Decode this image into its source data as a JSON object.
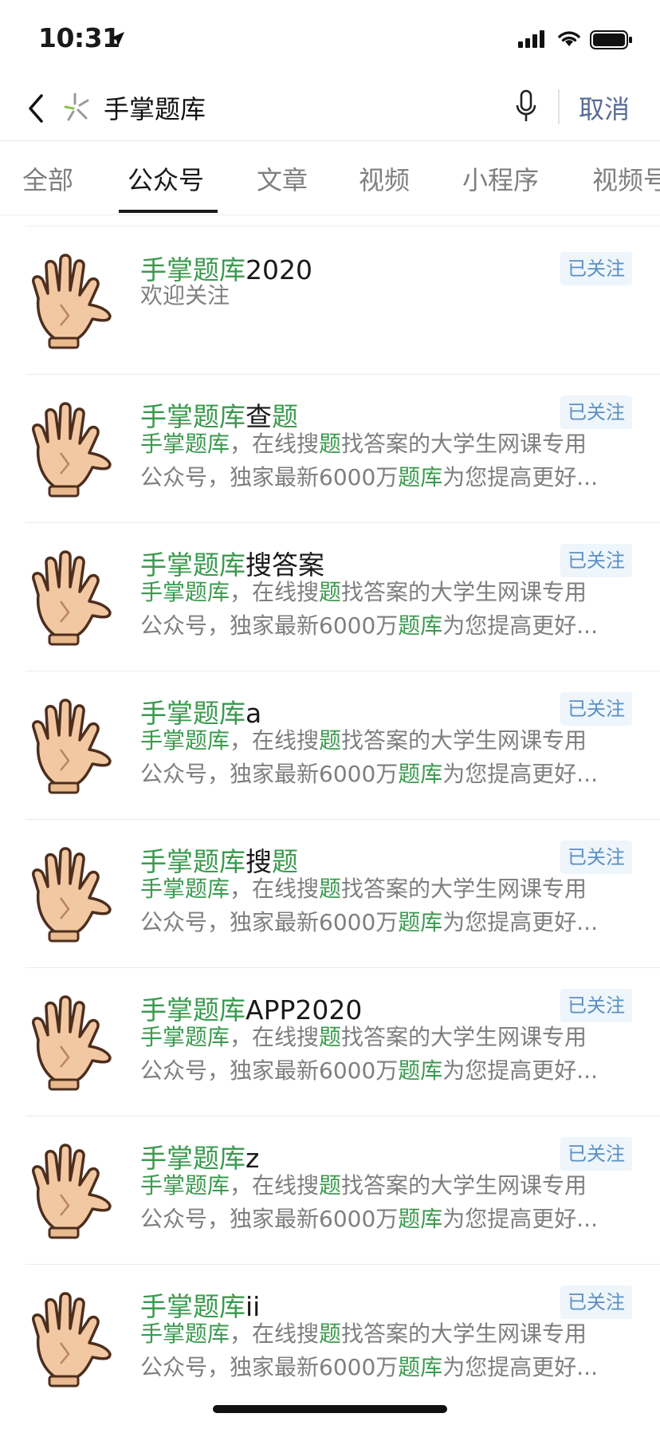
{
  "status_bar": {
    "time": "10:31"
  },
  "search": {
    "query": "手掌题库",
    "cancel_label": "取消"
  },
  "tabs": [
    {
      "label": "全部"
    },
    {
      "label": "公众号"
    },
    {
      "label": "文章"
    },
    {
      "label": "视频"
    },
    {
      "label": "小程序"
    },
    {
      "label": "视频号"
    }
  ],
  "active_tab": "公众号",
  "colors": {
    "highlight": "#3a9a4e",
    "link": "#576b95",
    "follow_badge_bg": "#eef5fb",
    "follow_badge_text": "#5b8fc2"
  },
  "results": [
    {
      "title_hl": "手掌题库",
      "title_rest": "2020",
      "follow": "已关注",
      "desc_simple": "欢迎关注"
    },
    {
      "title_hl": "手掌题库",
      "title_rest": "查",
      "title_hl2": "题",
      "follow": "已关注",
      "desc1_a": "手掌题库",
      "desc1_b": "，在线搜",
      "desc1_c": "题",
      "desc1_d": "找答案的大学生网课专用",
      "desc2_a": "公众号，独家最新6000万",
      "desc2_b": "题库",
      "desc2_c": "为您提高更好..."
    },
    {
      "title_hl": "手掌题库",
      "title_rest": "搜答案",
      "follow": "已关注",
      "desc1_a": "手掌题库",
      "desc1_b": "，在线搜",
      "desc1_c": "题",
      "desc1_d": "找答案的大学生网课专用",
      "desc2_a": "公众号，独家最新6000万",
      "desc2_b": "题库",
      "desc2_c": "为您提高更好..."
    },
    {
      "title_hl": "手掌题库",
      "title_rest": "a",
      "follow": "已关注",
      "desc1_a": "手掌题库",
      "desc1_b": "，在线搜",
      "desc1_c": "题",
      "desc1_d": "找答案的大学生网课专用",
      "desc2_a": "公众号，独家最新6000万",
      "desc2_b": "题库",
      "desc2_c": "为您提高更好..."
    },
    {
      "title_hl": "手掌题库",
      "title_rest": "搜",
      "title_hl2": "题",
      "follow": "已关注",
      "desc1_a": "手掌题库",
      "desc1_b": "，在线搜",
      "desc1_c": "题",
      "desc1_d": "找答案的大学生网课专用",
      "desc2_a": "公众号，独家最新6000万",
      "desc2_b": "题库",
      "desc2_c": "为您提高更好..."
    },
    {
      "title_hl": "手掌题库",
      "title_rest": "APP2020",
      "follow": "已关注",
      "desc1_a": "手掌题库",
      "desc1_b": "，在线搜",
      "desc1_c": "题",
      "desc1_d": "找答案的大学生网课专用",
      "desc2_a": "公众号，独家最新6000万",
      "desc2_b": "题库",
      "desc2_c": "为您提高更好..."
    },
    {
      "title_hl": "手掌题库",
      "title_rest": "z",
      "follow": "已关注",
      "desc1_a": "手掌题库",
      "desc1_b": "，在线搜",
      "desc1_c": "题",
      "desc1_d": "找答案的大学生网课专用",
      "desc2_a": "公众号，独家最新6000万",
      "desc2_b": "题库",
      "desc2_c": "为您提高更好..."
    },
    {
      "title_hl": "手掌题库",
      "title_rest": "ii",
      "follow": "已关注",
      "desc1_a": "手掌题库",
      "desc1_b": "，在线搜",
      "desc1_c": "题",
      "desc1_d": "找答案的大学生网课专用",
      "desc2_a": "公众号，独家最新6000万",
      "desc2_b": "题库",
      "desc2_c": "为您提高更好..."
    }
  ]
}
